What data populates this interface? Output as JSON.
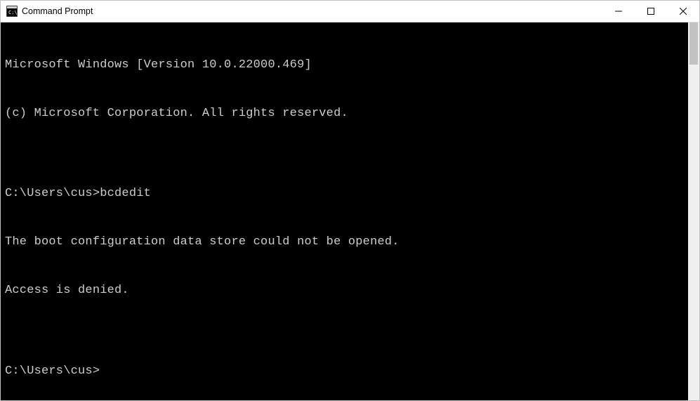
{
  "titlebar": {
    "title": "Command Prompt",
    "icon_name": "cmd-prompt-icon"
  },
  "terminal": {
    "lines": [
      "Microsoft Windows [Version 10.0.22000.469]",
      "(c) Microsoft Corporation. All rights reserved.",
      "",
      "C:\\Users\\cus>bcdedit",
      "The boot configuration data store could not be opened.",
      "Access is denied.",
      "",
      "C:\\Users\\cus>"
    ]
  }
}
